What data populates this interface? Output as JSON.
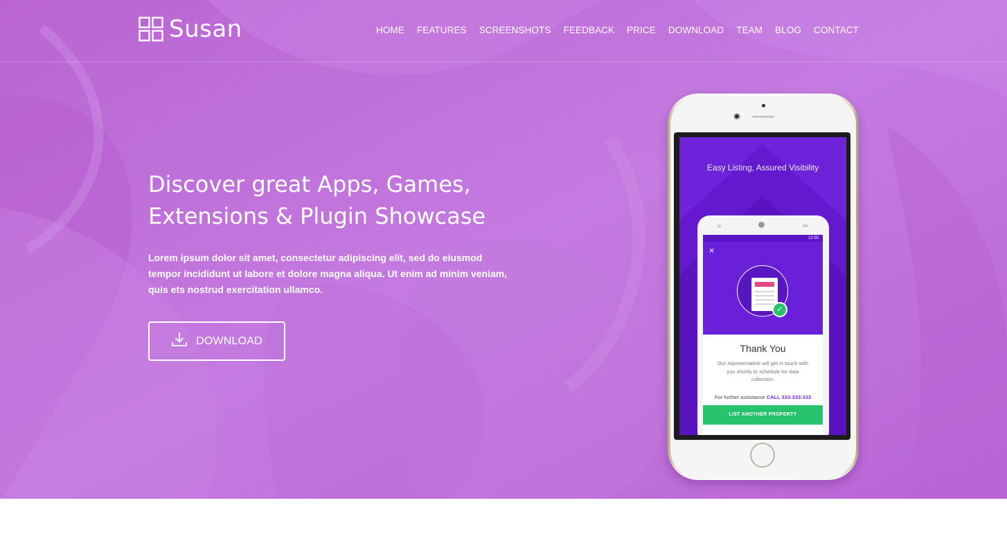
{
  "colors": {
    "hero_background": "#c072d8",
    "accent_text": "#ffffff",
    "app_screen_purple": "#6a1fd8",
    "app_button_green": "#27c26c",
    "app_pink": "#e84583"
  },
  "brand": {
    "name": "Susan",
    "icon": "grid-four-squares-icon"
  },
  "nav": {
    "items": [
      {
        "label": "HOME"
      },
      {
        "label": "FEATURES"
      },
      {
        "label": "SCREENSHOTS"
      },
      {
        "label": "FEEDBACK"
      },
      {
        "label": "PRICE"
      },
      {
        "label": "DOWNLOAD"
      },
      {
        "label": "TEAM"
      },
      {
        "label": "BLOG"
      },
      {
        "label": "CONTACT"
      }
    ]
  },
  "hero": {
    "headline_line1": "Discover great Apps, Games,",
    "headline_line2": "Extensions & Plugin Showcase",
    "lead": "Lorem ipsum dolor sit amet, consectetur adipiscing elit, sed do eiusmod tempor incididunt ut labore et dolore magna aliqua. Ut enim ad minim veniam, quis ets nostrud exercitation ullamco.",
    "download_label": "DOWNLOAD",
    "download_icon": "download-icon"
  },
  "phone_mockup": {
    "screen_title": "Easy Listing, Assured Visibility",
    "status_time": "12:30",
    "close_glyph": "×",
    "thank_you": "Thank You",
    "message": "Our representative will get in touch with you shortly to schedule for data collection.",
    "assist_prefix": "For further assistance",
    "assist_call": "CALL 333-333-333",
    "list_button": "LIST ANOTHER PROPERTY",
    "check_glyph": "✓"
  }
}
